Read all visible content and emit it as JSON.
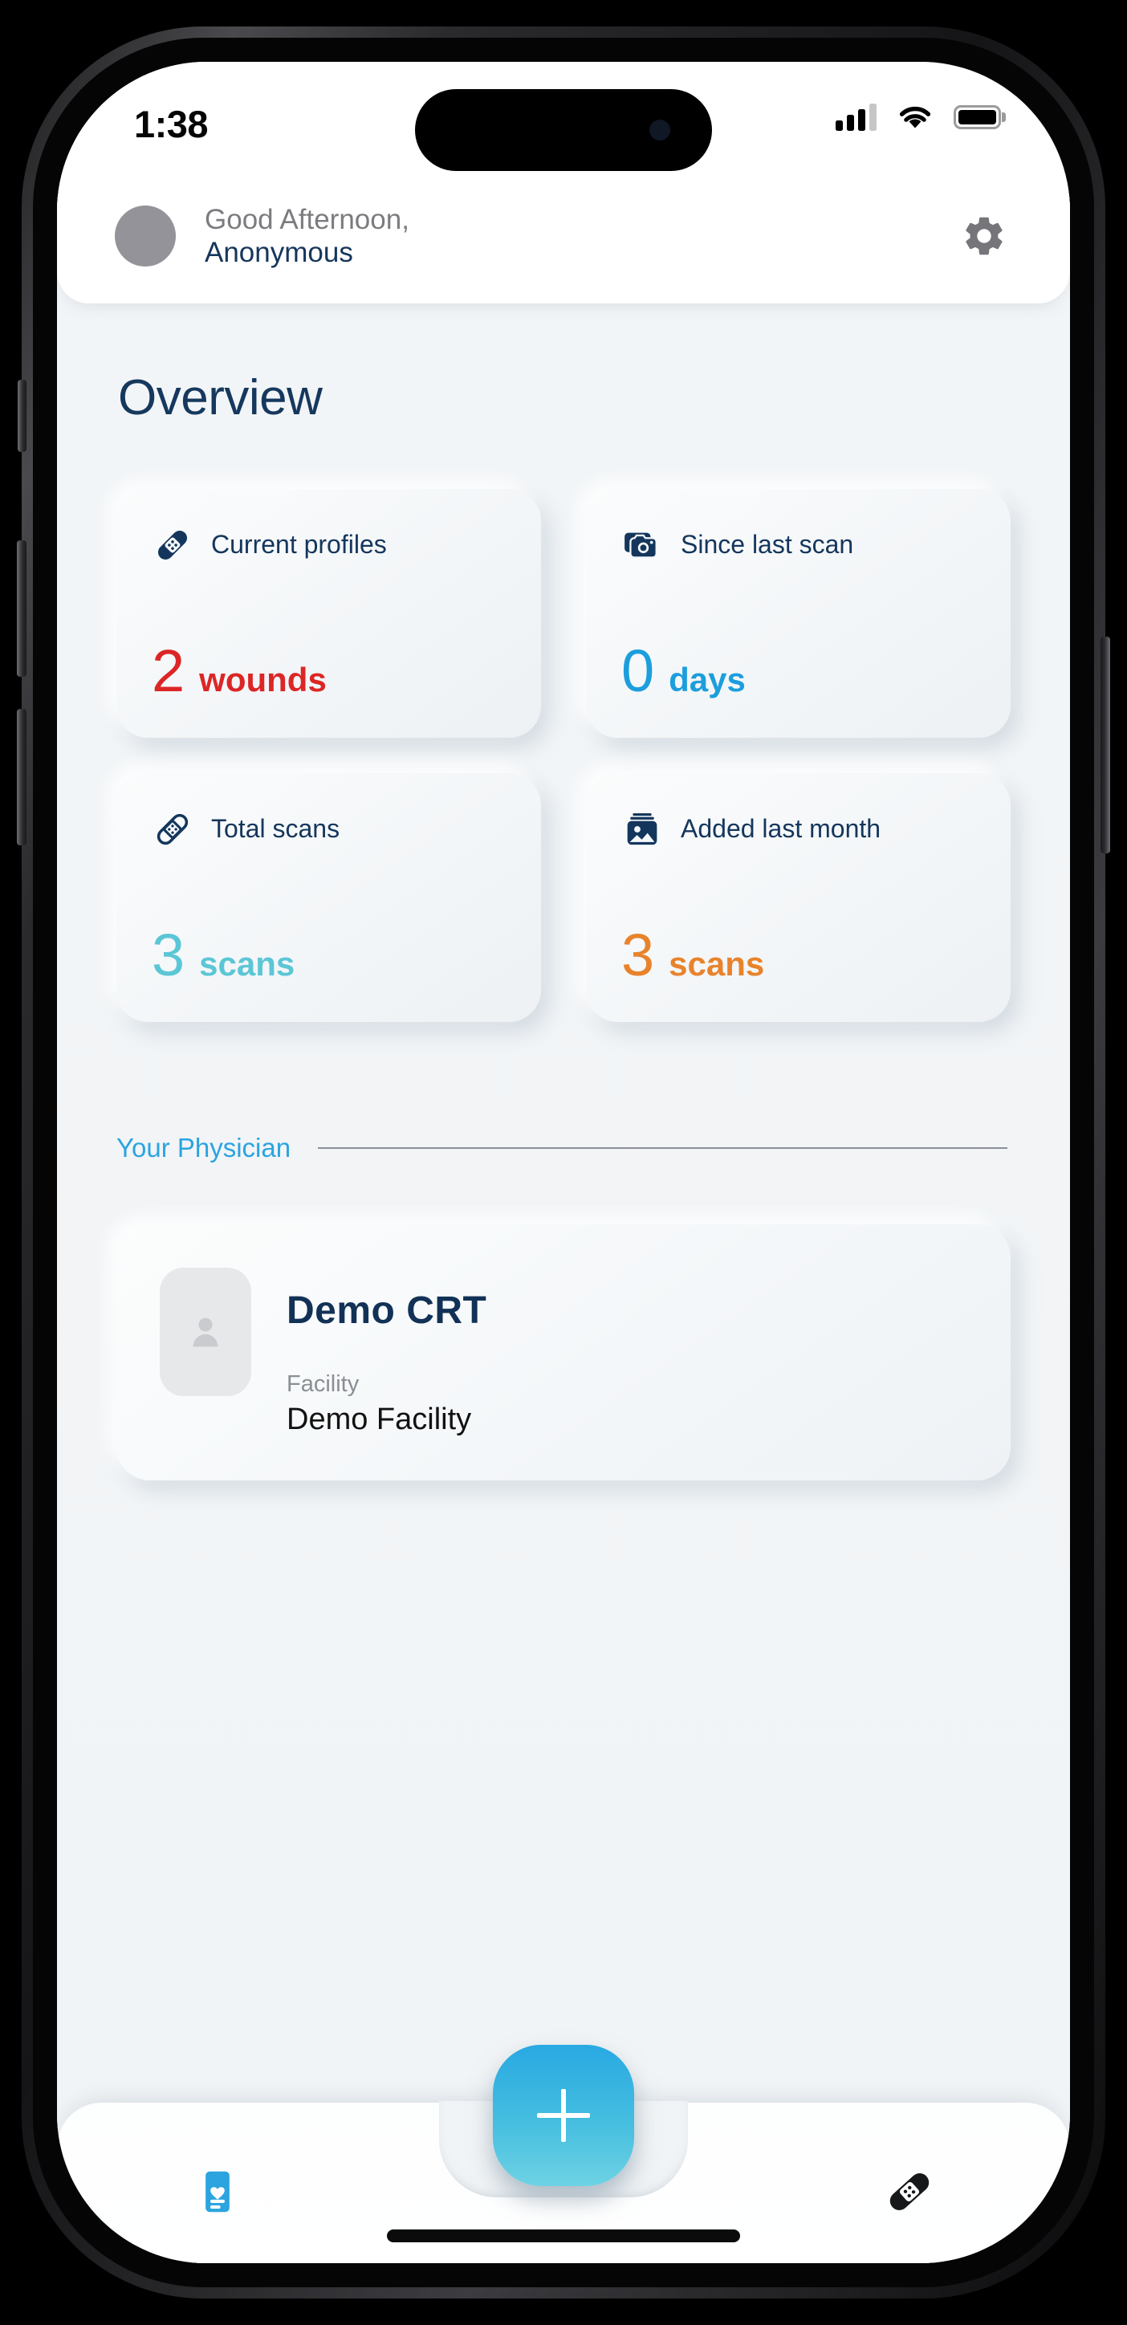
{
  "status_bar": {
    "time": "1:38",
    "signal_icon": "cellular-signal-icon",
    "wifi_icon": "wifi-icon",
    "battery_icon": "battery-full-icon"
  },
  "header": {
    "avatar_icon": "user-avatar-placeholder",
    "greeting": "Good Afternoon,",
    "user_name": "Anonymous",
    "settings_icon": "gear-icon"
  },
  "overview": {
    "title": "Overview",
    "cards": [
      {
        "icon": "bandage-filled-icon",
        "label": "Current profiles",
        "value": "2",
        "unit": "wounds",
        "color": "#DC2626"
      },
      {
        "icon": "camera-stack-icon",
        "label": "Since last scan",
        "value": "0",
        "unit": "days",
        "color": "#1C9EDC"
      },
      {
        "icon": "bandage-outline-icon",
        "label": "Total scans",
        "value": "3",
        "unit": "scans",
        "color": "#5BC6D6"
      },
      {
        "icon": "photo-stack-icon",
        "label": "Added last month",
        "value": "3",
        "unit": "scans",
        "color": "#E8832C"
      }
    ]
  },
  "physician": {
    "section_title": "Your Physician",
    "avatar_icon": "person-placeholder-icon",
    "name": "Demo  CRT",
    "facility_label": "Facility",
    "facility_name": "Demo Facility"
  },
  "bottom_nav": {
    "left_item_icon": "health-record-card-icon",
    "add_button_icon": "plus-icon",
    "right_item_icon": "bandage-icon",
    "fab_gradient_from": "#28A9E2",
    "fab_gradient_to": "#6ED2E4"
  },
  "theme": {
    "navy": "#16385E",
    "accent_blue": "#2BA4E0",
    "background": "#F1F4F6"
  }
}
